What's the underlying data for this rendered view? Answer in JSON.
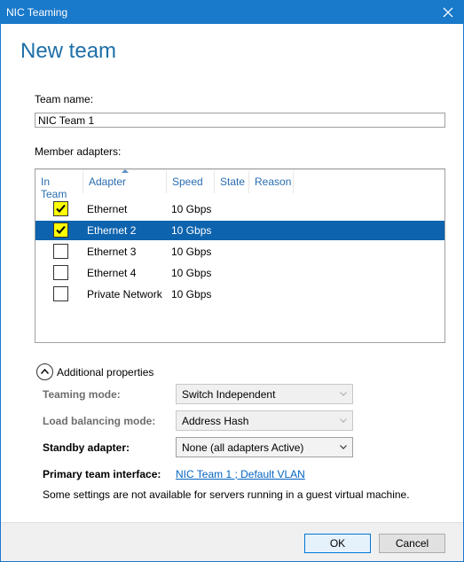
{
  "window": {
    "title": "NIC Teaming"
  },
  "page": {
    "heading": "New team"
  },
  "team_name": {
    "label": "Team name:",
    "value": "NIC Team 1"
  },
  "member_adapters": {
    "label": "Member adapters:",
    "columns": [
      "In Team",
      "Adapter",
      "Speed",
      "State",
      "Reason"
    ],
    "rows": [
      {
        "in_team": true,
        "adapter": "Ethernet",
        "speed": "10 Gbps",
        "state": "",
        "reason": "",
        "selected": false
      },
      {
        "in_team": true,
        "adapter": "Ethernet 2",
        "speed": "10 Gbps",
        "state": "",
        "reason": "",
        "selected": true
      },
      {
        "in_team": false,
        "adapter": "Ethernet 3",
        "speed": "10 Gbps",
        "state": "",
        "reason": "",
        "selected": false
      },
      {
        "in_team": false,
        "adapter": "Ethernet 4",
        "speed": "10 Gbps",
        "state": "",
        "reason": "",
        "selected": false
      },
      {
        "in_team": false,
        "adapter": "Private Network",
        "speed": "10 Gbps",
        "state": "",
        "reason": "",
        "selected": false
      }
    ]
  },
  "additional": {
    "label": "Additional properties",
    "teaming_mode": {
      "label": "Teaming mode:",
      "value": "Switch Independent"
    },
    "load_balancing": {
      "label": "Load balancing mode:",
      "value": "Address Hash"
    },
    "standby": {
      "label": "Standby adapter:",
      "value": "None (all adapters Active)"
    },
    "primary_interface": {
      "label": "Primary team interface:",
      "link": "NIC Team 1 ; Default VLAN"
    },
    "note": "Some settings are not available for servers running in a guest virtual machine."
  },
  "buttons": {
    "ok": "OK",
    "cancel": "Cancel"
  },
  "colors": {
    "accent": "#1979ca",
    "selection": "#0d63ad",
    "checkbox_highlight": "#ffff00"
  }
}
